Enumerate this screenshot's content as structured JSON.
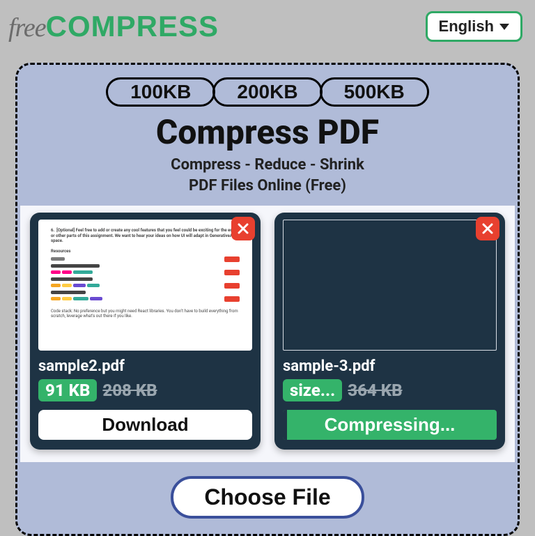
{
  "header": {
    "logo_free": "free",
    "logo_compress": "COMPRESS",
    "language_label": "English"
  },
  "sizes": [
    "100KB",
    "200KB",
    "500KB"
  ],
  "title": "Compress PDF",
  "subtitle_line1": "Compress - Reduce - Shrink",
  "subtitle_line2": "PDF Files Online (Free)",
  "files": [
    {
      "name": "sample2.pdf",
      "new_size": "91 KB",
      "old_size": "208 KB",
      "action_label": "Download",
      "has_preview": true
    },
    {
      "name": "sample-3.pdf",
      "new_size": "size...",
      "old_size": "364 KB",
      "action_label": "Compressing...",
      "has_preview": false
    }
  ],
  "choose_file_label": "Choose File"
}
